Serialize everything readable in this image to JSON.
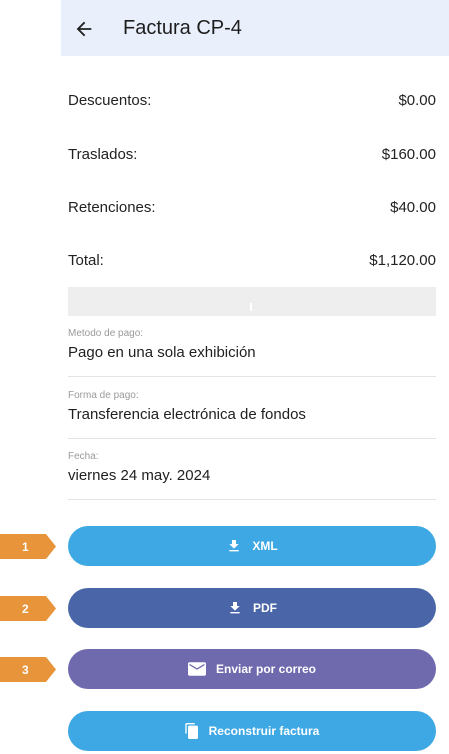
{
  "header": {
    "title": "Factura CP-4"
  },
  "totals": [
    {
      "label": "Descuentos:",
      "value": "$0.00"
    },
    {
      "label": "Traslados:",
      "value": "$160.00"
    },
    {
      "label": "Retenciones:",
      "value": "$40.00"
    },
    {
      "label": "Total:",
      "value": "$1,120.00"
    }
  ],
  "fields": [
    {
      "label": "Metodo de pago:",
      "value": "Pago en una sola exhibición"
    },
    {
      "label": "Forma de pago:",
      "value": "Transferencia electrónica de fondos"
    },
    {
      "label": "Fecha:",
      "value": "viernes 24 may. 2024"
    }
  ],
  "buttons": {
    "xml": "XML",
    "pdf": "PDF",
    "email": "Enviar por correo",
    "rebuild": "Reconstruir factura"
  },
  "badges": [
    "1",
    "2",
    "3"
  ],
  "colors": {
    "header_bg": "#e9f0fb",
    "light_blue": "#3ea8e4",
    "dark_blue": "#4a66a8",
    "purple": "#6f6aad",
    "badge_orange": "#e8943a"
  }
}
